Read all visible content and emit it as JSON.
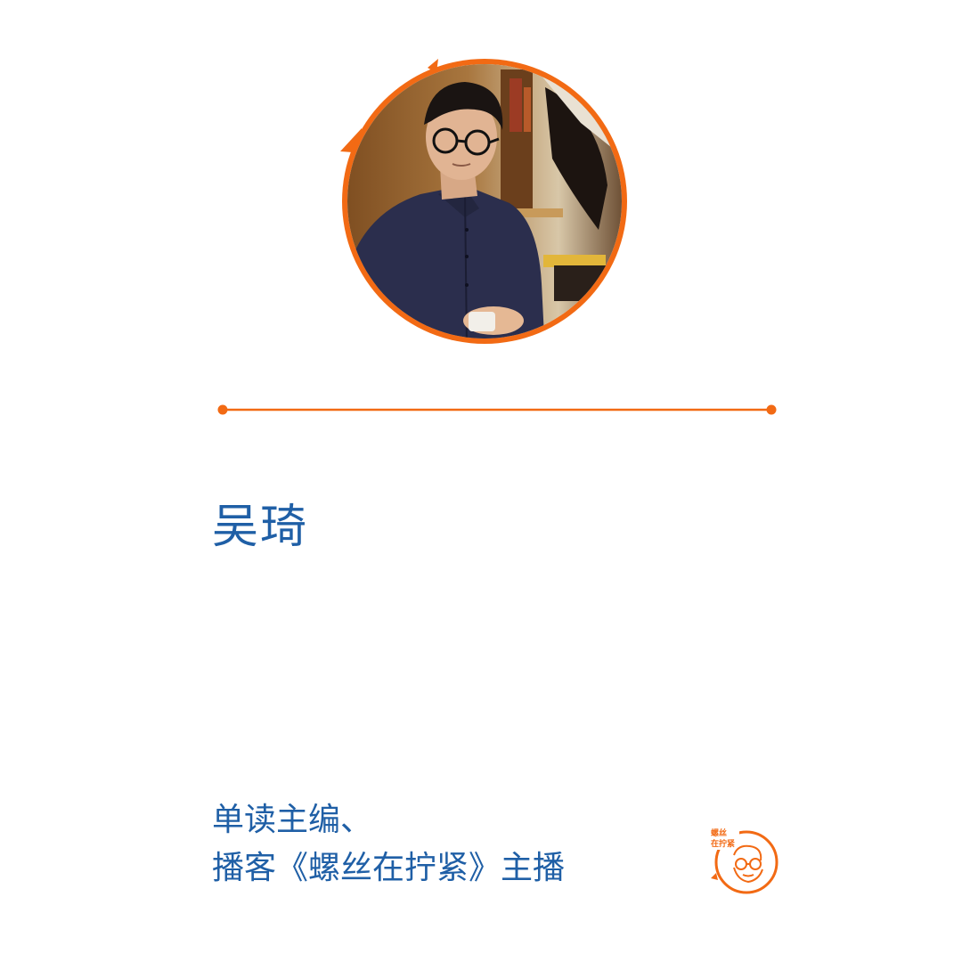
{
  "colors": {
    "accent": "#f26a14",
    "text": "#1f5fa6",
    "background": "#ffffff"
  },
  "profile": {
    "name": "吴琦",
    "role_line_1": "单读主编、",
    "role_line_2": "播客《螺丝在拧紧》主播"
  },
  "portrait": {
    "icon": "portrait-photo"
  },
  "logo": {
    "text_line_1": "螺丝",
    "text_line_2": "在拧紧",
    "icon": "podcast-logo-icon"
  }
}
